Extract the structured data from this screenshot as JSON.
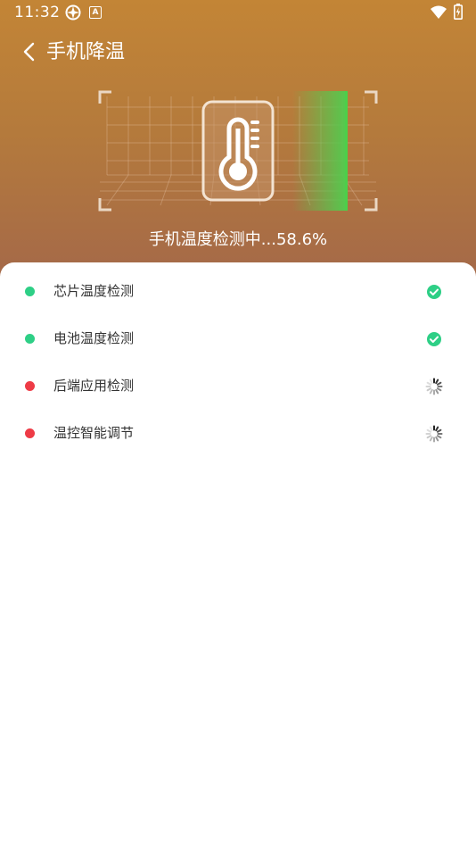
{
  "status_bar": {
    "time": "11:32",
    "icon_a_letter": "A"
  },
  "header": {
    "title": "手机降温",
    "back_icon": "chevron-left-icon"
  },
  "scan": {
    "caption": "手机温度检测中...58.6%",
    "progress_percent": 58.6
  },
  "colors": {
    "done": "#2ecf86",
    "pending": "#ee3b46",
    "header_top": "#c38536",
    "header_bottom": "#a3674a"
  },
  "checks": [
    {
      "label": "芯片温度检测",
      "state": "done",
      "status_icon": "check-circle-icon"
    },
    {
      "label": "电池温度检测",
      "state": "done",
      "status_icon": "check-circle-icon"
    },
    {
      "label": "后端应用检测",
      "state": "pending",
      "status_icon": "loading-spinner-icon"
    },
    {
      "label": "温控智能调节",
      "state": "pending",
      "status_icon": "loading-spinner-icon"
    }
  ]
}
